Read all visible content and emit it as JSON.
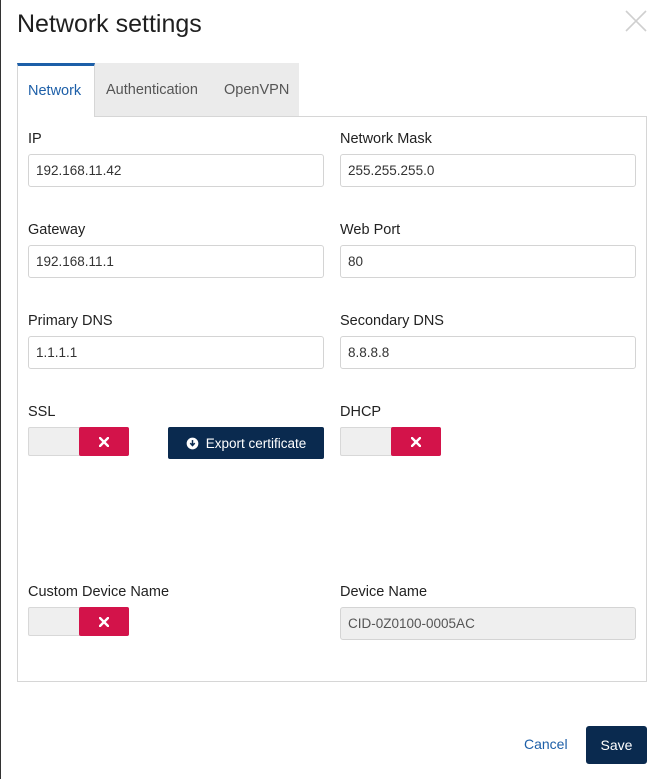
{
  "dialog": {
    "title": "Network settings"
  },
  "tabs": [
    {
      "label": "Network",
      "active": true
    },
    {
      "label": "Authentication",
      "active": false
    },
    {
      "label": "OpenVPN",
      "active": false
    }
  ],
  "fields": {
    "ip": {
      "label": "IP",
      "value": "192.168.11.42"
    },
    "network_mask": {
      "label": "Network Mask",
      "value": "255.255.255.0"
    },
    "gateway": {
      "label": "Gateway",
      "value": "192.168.11.1"
    },
    "web_port": {
      "label": "Web Port",
      "value": "80"
    },
    "primary_dns": {
      "label": "Primary DNS",
      "value": "1.1.1.1"
    },
    "secondary_dns": {
      "label": "Secondary DNS",
      "value": "8.8.8.8"
    },
    "device_name": {
      "label": "Device Name",
      "value": "CID-0Z0100-0005AC"
    }
  },
  "toggles": {
    "ssl": {
      "label": "SSL",
      "state": "off"
    },
    "dhcp": {
      "label": "DHCP",
      "state": "off"
    },
    "custom_device_name": {
      "label": "Custom Device Name",
      "state": "off"
    }
  },
  "buttons": {
    "export_certificate": "Export certificate",
    "cancel": "Cancel",
    "save": "Save"
  },
  "icons": {
    "close": "close-icon",
    "toggle_off": "x-icon",
    "export": "download-circle-icon"
  },
  "colors": {
    "accent": "#1d5fa8",
    "primary_button": "#0a2a4f",
    "toggle_off": "#d3134a",
    "tab_inactive_bg": "#ebebeb"
  }
}
